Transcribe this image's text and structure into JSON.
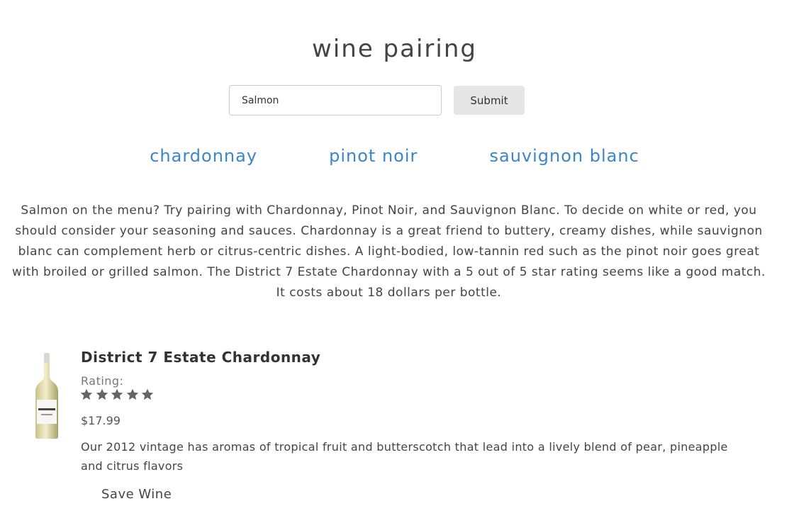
{
  "page": {
    "title": "wine pairing"
  },
  "search": {
    "value": "Salmon",
    "placeholder": "",
    "submit_label": "Submit"
  },
  "varietals": [
    {
      "label": "chardonnay"
    },
    {
      "label": "pinot noir"
    },
    {
      "label": "sauvignon blanc"
    }
  ],
  "pairing_text": "Salmon on the menu? Try pairing with Chardonnay, Pinot Noir, and Sauvignon Blanc. To decide on white or red, you should consider your seasoning and sauces. Chardonnay is a great friend to buttery, creamy dishes, while sauvignon blanc can complement herb or citrus-centric dishes. A light-bodied, low-tannin red such as the pinot noir goes great with broiled or grilled salmon. The District 7 Estate Chardonnay with a 5 out of 5 star rating seems like a good match. It costs about 18 dollars per bottle.",
  "wine": {
    "name": "District 7 Estate Chardonnay",
    "rating_label": "Rating:",
    "rating": 5,
    "rating_max": 5,
    "price": "$17.99",
    "description": "Our 2012 vintage has aromas of tropical fruit and butterscotch that lead into a lively blend of pear, pineapple and citrus flavors",
    "image_icon": "wine-bottle-icon",
    "save_label": "Save Wine"
  },
  "colors": {
    "link": "#3a86c8",
    "button_bg": "#e6e6e6",
    "star": "#666666"
  }
}
